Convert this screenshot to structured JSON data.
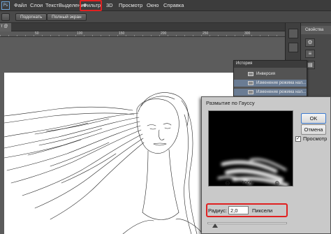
{
  "app": {
    "logo": "Ps"
  },
  "menu": {
    "items": [
      {
        "label": "Файл"
      },
      {
        "label": "Слои"
      },
      {
        "label": "Текст"
      },
      {
        "label": "Выделение"
      },
      {
        "label": "Фильтр",
        "highlighted": true
      },
      {
        "label": "3D"
      },
      {
        "label": "Просмотр"
      },
      {
        "label": "Окно"
      },
      {
        "label": "Справка"
      }
    ],
    "highlight_color": "#e02020"
  },
  "options_bar": {
    "buttons": [
      {
        "label": "Подогнать"
      },
      {
        "label": "Полный экран"
      }
    ]
  },
  "document_tab": {
    "label": "т @"
  },
  "ruler": {
    "labels": [
      "50",
      "100",
      "150",
      "200",
      "250",
      "300"
    ]
  },
  "right_dock": {
    "properties_tab": "Свойства",
    "icons": [
      "properties-icon",
      "adjust-icon",
      "layers-icon"
    ]
  },
  "history_panel": {
    "title": "История",
    "rows": [
      {
        "label": "Инверсия",
        "selected": false
      },
      {
        "label": "Изменение режима нал...",
        "selected": true
      },
      {
        "label": "Изменение режима нал...",
        "selected": true
      }
    ]
  },
  "gaussian_dialog": {
    "title": "Размытие по Гауссу",
    "zoom_out": "⊖",
    "zoom_percent": "100%",
    "zoom_in": "⊕",
    "ok_label": "OK",
    "cancel_label": "Отмена",
    "preview_label": "Просмотр",
    "preview_checked": true,
    "radius_label": "Радиус:",
    "radius_value": "2,0",
    "radius_unit": "Пиксели",
    "slider_level": 0.1
  },
  "colors": {
    "accent_red": "#e02020",
    "selection": "#6a7c94",
    "workspace": "#535353"
  }
}
